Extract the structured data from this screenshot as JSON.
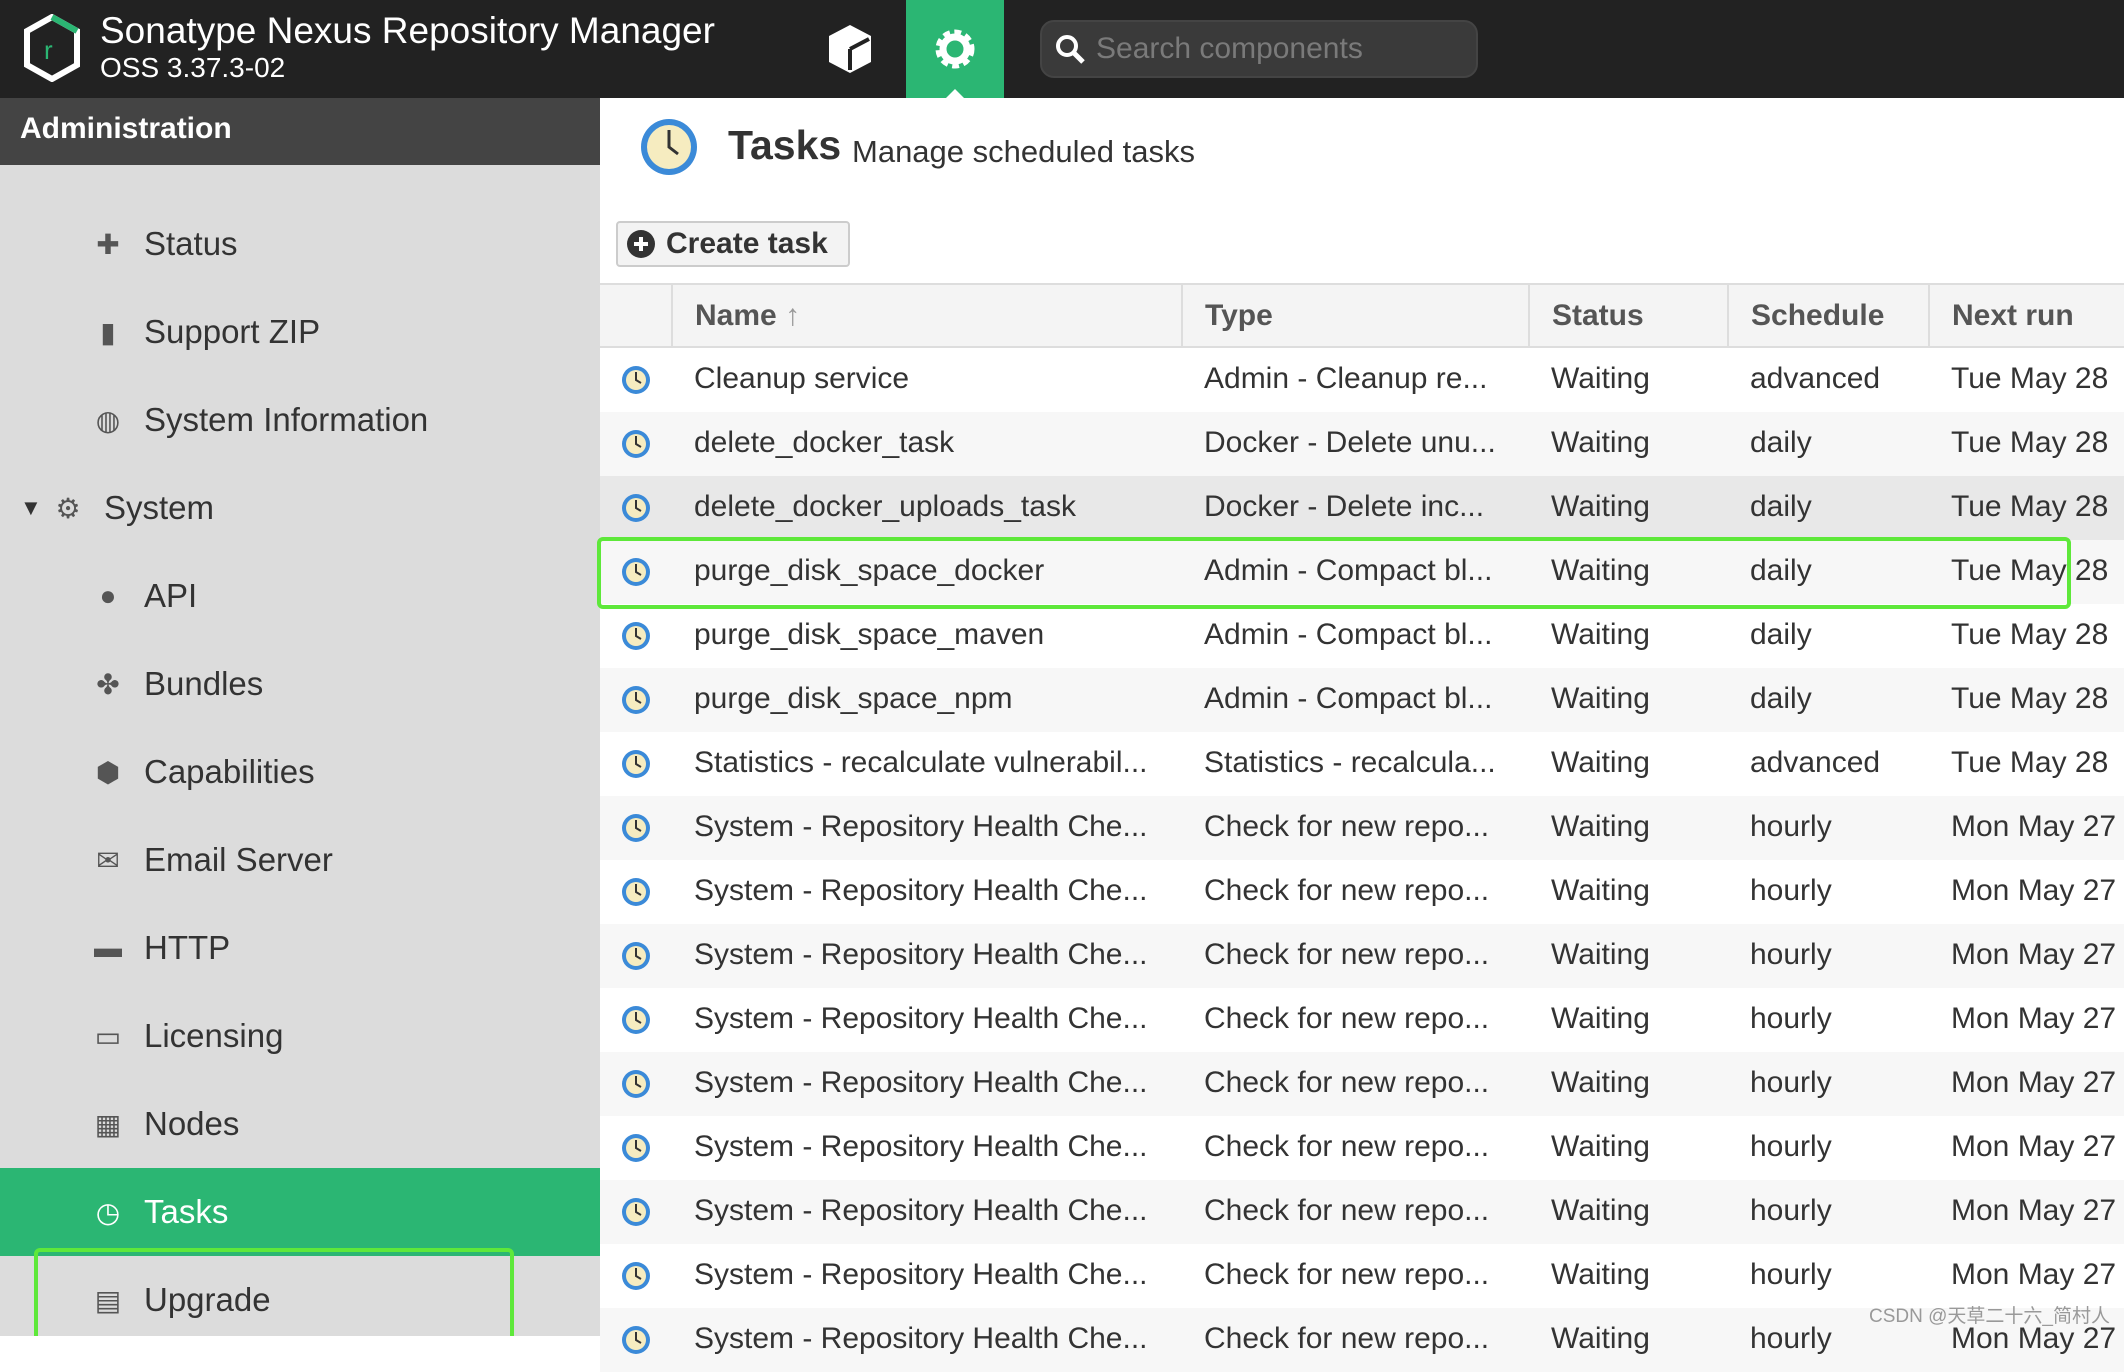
{
  "header": {
    "title": "Sonatype Nexus Repository Manager",
    "version": "OSS 3.37.3-02",
    "search_placeholder": "Search components",
    "accent": "#2bb673"
  },
  "sidebar": {
    "title": "Administration",
    "items": [
      {
        "label": "Status",
        "icon": "first-aid-icon",
        "indent": 1
      },
      {
        "label": "Support ZIP",
        "icon": "zip-file-icon",
        "indent": 1
      },
      {
        "label": "System Information",
        "icon": "globe-icon",
        "indent": 1
      },
      {
        "label": "System",
        "icon": "gear-icon",
        "indent": 0,
        "expanded": true
      },
      {
        "label": "API",
        "icon": "api-icon",
        "indent": 1
      },
      {
        "label": "Bundles",
        "icon": "puzzle-icon",
        "indent": 1
      },
      {
        "label": "Capabilities",
        "icon": "box-icon",
        "indent": 1
      },
      {
        "label": "Email Server",
        "icon": "envelope-icon",
        "indent": 1
      },
      {
        "label": "HTTP",
        "icon": "truck-icon",
        "indent": 1
      },
      {
        "label": "Licensing",
        "icon": "license-icon",
        "indent": 1
      },
      {
        "label": "Nodes",
        "icon": "nodes-icon",
        "indent": 1
      },
      {
        "label": "Tasks",
        "icon": "clock-icon",
        "indent": 1,
        "selected": true
      },
      {
        "label": "Upgrade",
        "icon": "upgrade-icon",
        "indent": 1
      }
    ]
  },
  "main": {
    "title": "Tasks",
    "subtitle": "Manage scheduled tasks",
    "create_label": "Create task",
    "columns": [
      "Name",
      "Type",
      "Status",
      "Schedule",
      "Next run"
    ],
    "rows": [
      [
        "Cleanup service",
        "Admin - Cleanup re...",
        "Waiting",
        "advanced",
        "Tue May 28"
      ],
      [
        "delete_docker_task",
        "Docker - Delete unu...",
        "Waiting",
        "daily",
        "Tue May 28"
      ],
      [
        "delete_docker_uploads_task",
        "Docker - Delete inc...",
        "Waiting",
        "daily",
        "Tue May 28"
      ],
      [
        "purge_disk_space_docker",
        "Admin - Compact bl...",
        "Waiting",
        "daily",
        "Tue May 28"
      ],
      [
        "purge_disk_space_maven",
        "Admin - Compact bl...",
        "Waiting",
        "daily",
        "Tue May 28"
      ],
      [
        "purge_disk_space_npm",
        "Admin - Compact bl...",
        "Waiting",
        "daily",
        "Tue May 28"
      ],
      [
        "Statistics - recalculate vulnerabil...",
        "Statistics - recalcula...",
        "Waiting",
        "advanced",
        "Tue May 28"
      ],
      [
        "System - Repository Health Che...",
        "Check for new repo...",
        "Waiting",
        "hourly",
        "Mon May 27"
      ],
      [
        "System - Repository Health Che...",
        "Check for new repo...",
        "Waiting",
        "hourly",
        "Mon May 27"
      ],
      [
        "System - Repository Health Che...",
        "Check for new repo...",
        "Waiting",
        "hourly",
        "Mon May 27"
      ],
      [
        "System - Repository Health Che...",
        "Check for new repo...",
        "Waiting",
        "hourly",
        "Mon May 27"
      ],
      [
        "System - Repository Health Che...",
        "Check for new repo...",
        "Waiting",
        "hourly",
        "Mon May 27"
      ],
      [
        "System - Repository Health Che...",
        "Check for new repo...",
        "Waiting",
        "hourly",
        "Mon May 27"
      ],
      [
        "System - Repository Health Che...",
        "Check for new repo...",
        "Waiting",
        "hourly",
        "Mon May 27"
      ],
      [
        "System - Repository Health Che...",
        "Check for new repo...",
        "Waiting",
        "hourly",
        "Mon May 27"
      ],
      [
        "System - Repository Health Che...",
        "Check for new repo...",
        "Waiting",
        "hourly",
        "Mon May 27"
      ]
    ]
  },
  "watermark": "CSDN @天草二十六_简村人"
}
